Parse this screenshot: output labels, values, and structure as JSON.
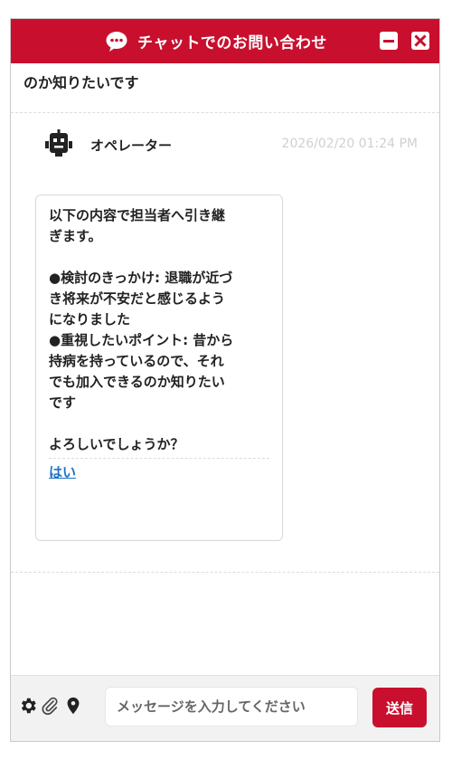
{
  "header": {
    "title": "チャットでのお問い合わせ",
    "chat_icon": "chat-bubble-icon",
    "minimize_icon": "minimize-icon",
    "close_icon": "close-icon"
  },
  "messages": {
    "previous_tail": "のか知りたいです",
    "operator": {
      "name": "オペレーター",
      "avatar_icon": "robot-icon",
      "timestamp": "2026/02/20 01:24 PM",
      "lines": [
        "以下の内容で担当者へ引き継",
        "ぎます。",
        "",
        "●検討のきっかけ: 退職が近づ",
        "き将来が不安だと感じるよう",
        "になりました",
        "●重視したいポイント: 昔から",
        "持病を持っているので、それ",
        "でも加入できるのか知りたい",
        "です",
        "",
        "よろしいでしょうか？"
      ],
      "reply_option": "はい"
    }
  },
  "footer": {
    "input_value": "",
    "input_placeholder": "メッセージを入力してください",
    "send_label": "送信",
    "icons": [
      "gear-icon",
      "paperclip-icon",
      "location-pin-icon"
    ]
  },
  "colors": {
    "brand": "#c8102e",
    "link": "#1a73c7",
    "timestamp": "#d0d0d0"
  }
}
